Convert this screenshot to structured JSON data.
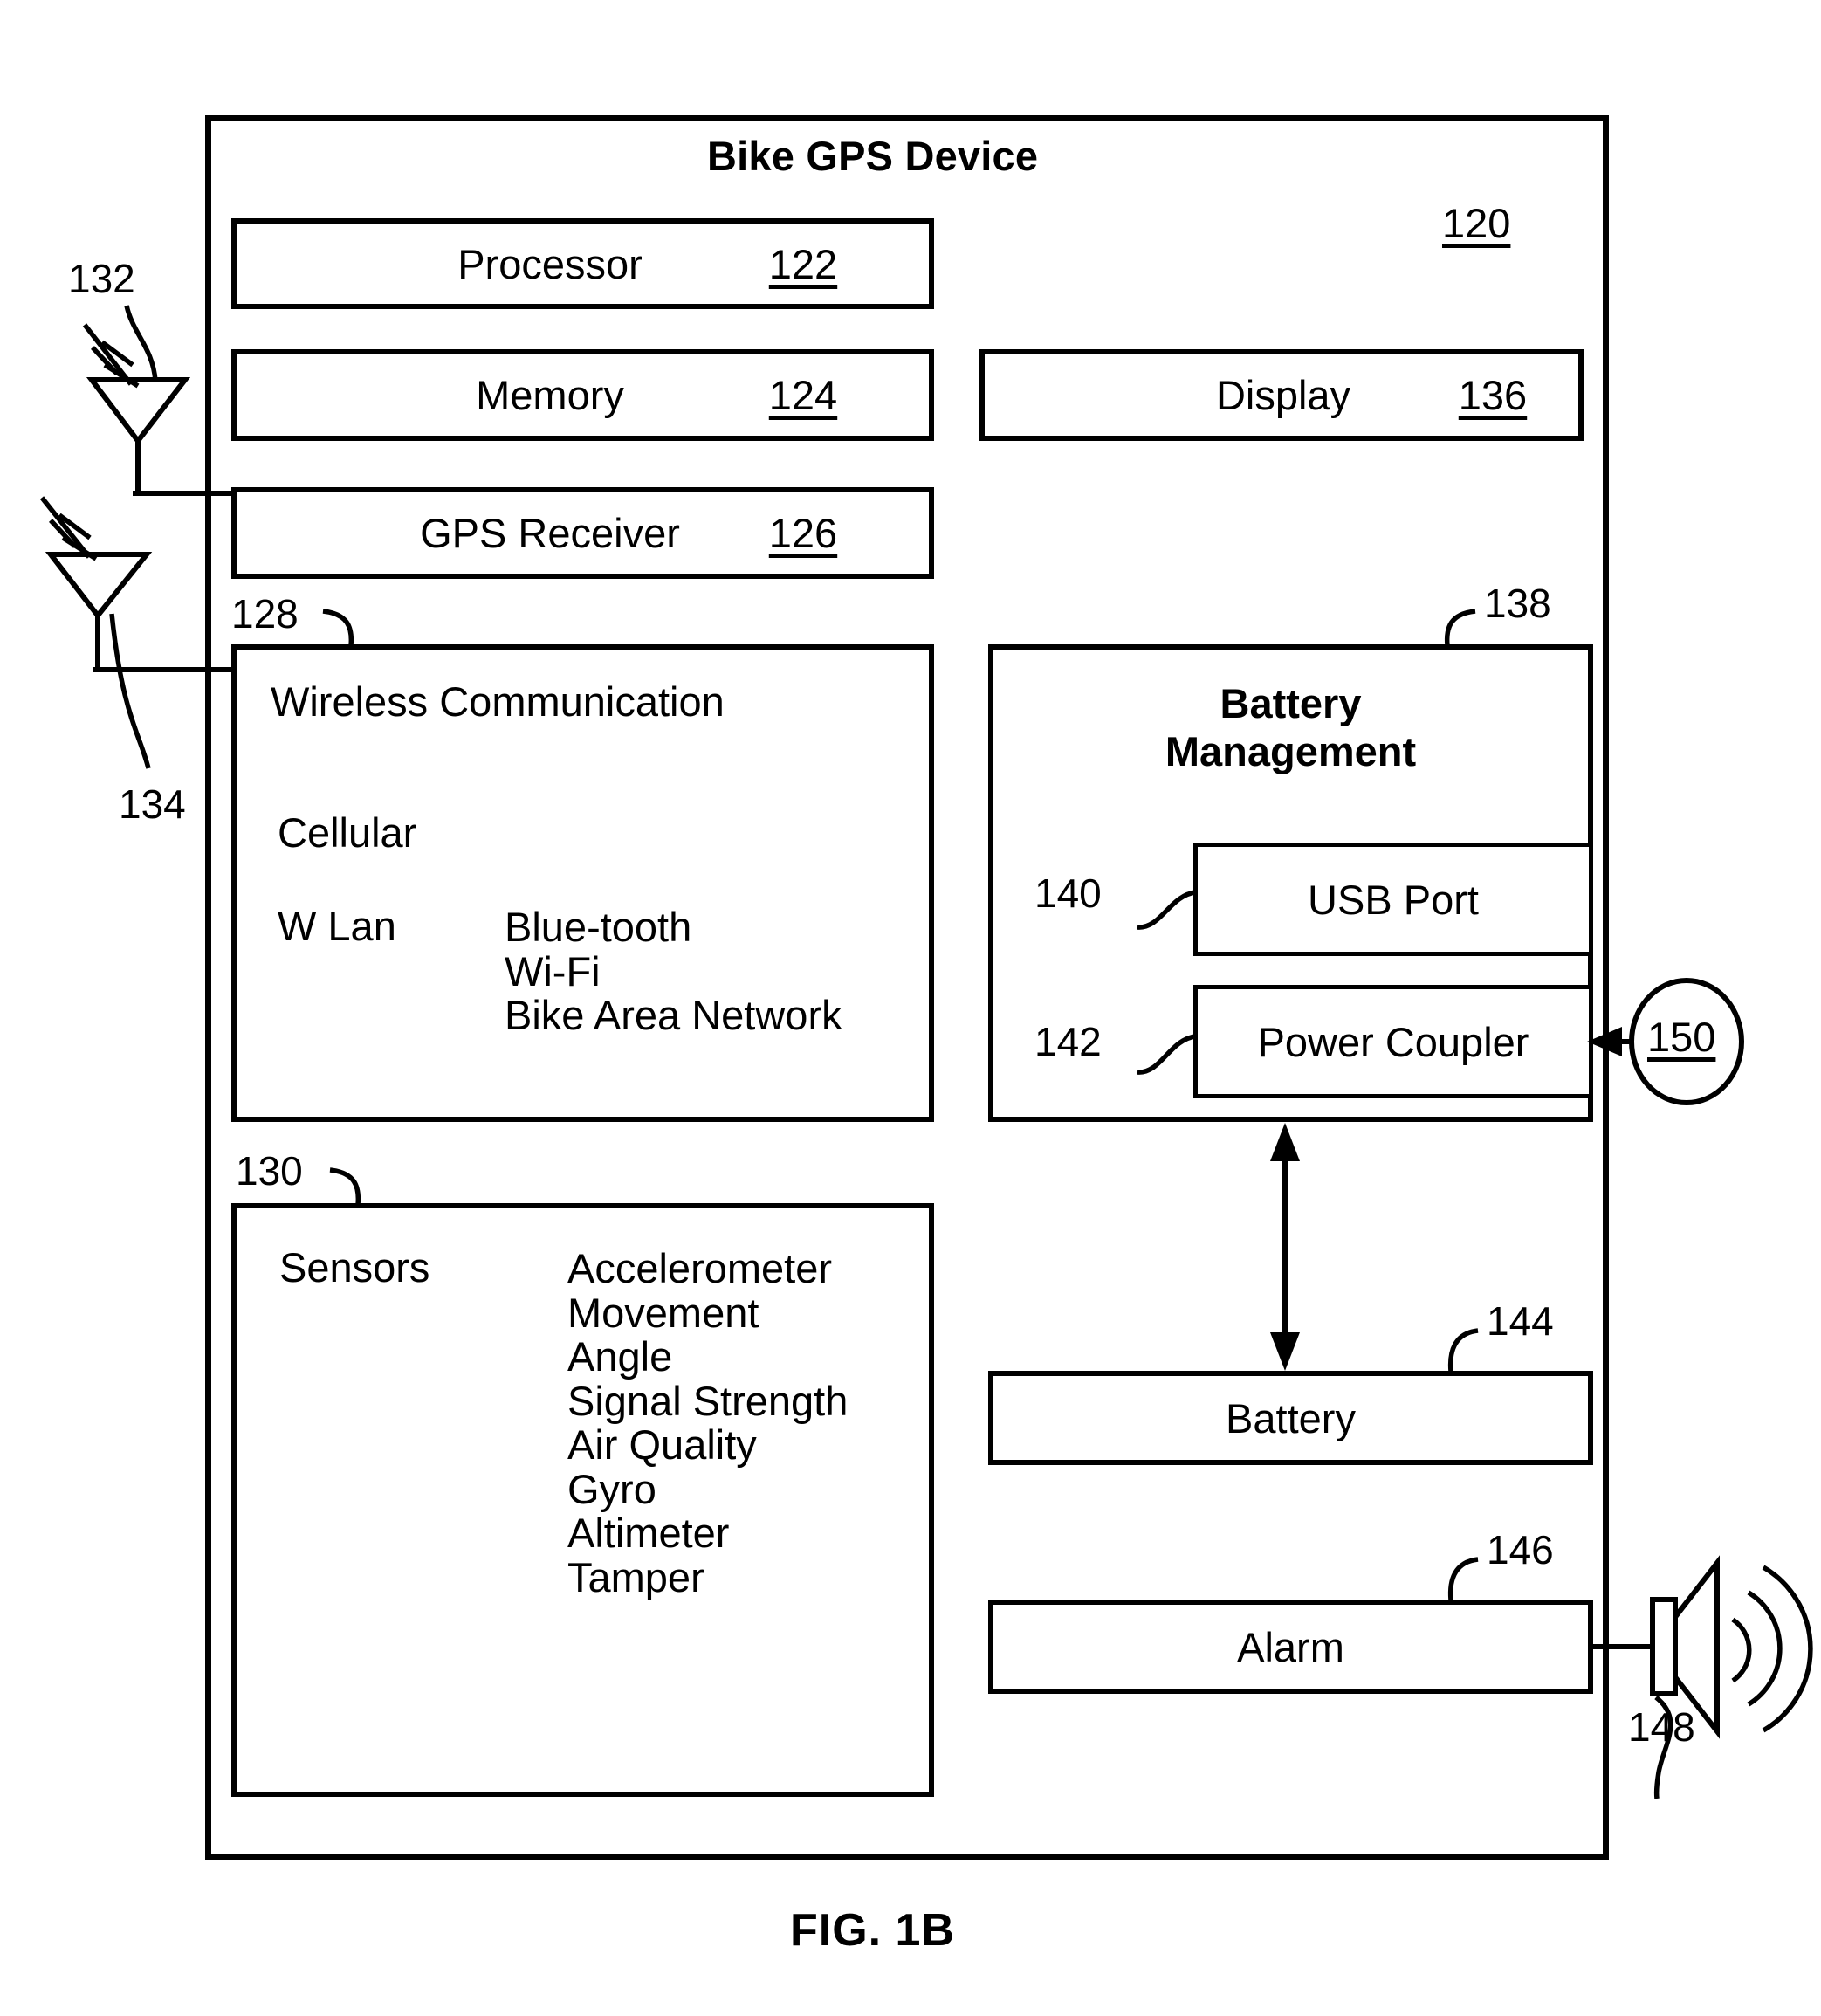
{
  "figure": {
    "caption": "FIG. 1B",
    "device_title": "Bike GPS Device",
    "device_ref": "120"
  },
  "device": {
    "modules": [
      {
        "name": "processor",
        "label": "Processor",
        "ref": "122"
      },
      {
        "name": "memory",
        "label": "Memory",
        "ref": "124"
      },
      {
        "name": "gps-receiver",
        "label": "GPS Receiver",
        "ref": "126"
      },
      {
        "name": "display",
        "label": "Display",
        "ref": "136"
      },
      {
        "name": "battery",
        "label": "Battery",
        "ref": "144"
      },
      {
        "name": "alarm",
        "label": "Alarm",
        "ref": "146"
      }
    ],
    "wireless": {
      "ref": "128",
      "title": "Wireless Communication",
      "cellular": "Cellular",
      "wlan": "W Lan",
      "wlan_types": "Blue-tooth\nWi-Fi\nBike Area Network"
    },
    "sensors": {
      "ref": "130",
      "title": "Sensors",
      "list": "Accelerometer\nMovement\nAngle\nSignal Strength\nAir Quality\nGyro\nAltimeter\nTamper"
    },
    "battery_management": {
      "ref": "138",
      "title": "Battery\nManagement",
      "usb_port": {
        "label": "USB Port",
        "ref": "140"
      },
      "power_coupler": {
        "label": "Power Coupler",
        "ref": "142"
      }
    },
    "externals": [
      {
        "name": "gps-antenna",
        "ref": "132",
        "icon": "antenna-icon"
      },
      {
        "name": "wireless-antenna",
        "ref": "134",
        "icon": "antenna-icon"
      },
      {
        "name": "power-source",
        "ref": "150",
        "icon": "circle-reference"
      },
      {
        "name": "speaker",
        "ref": "148",
        "icon": "speaker-icon"
      }
    ]
  },
  "colors": {
    "ink": "#000000",
    "paper": "#ffffff"
  }
}
